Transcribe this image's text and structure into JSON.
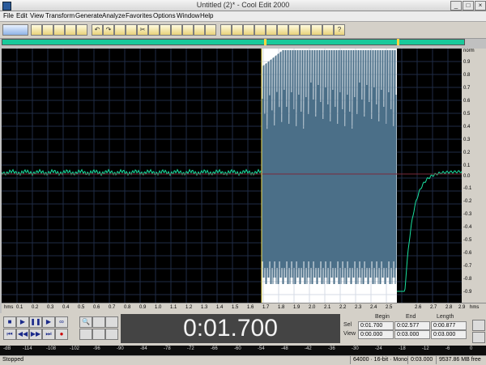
{
  "titlebar": {
    "title": "Untitled (2)* - Cool Edit 2000"
  },
  "menu": [
    "File",
    "Edit",
    "View",
    "Transform",
    "Generate",
    "Analyze",
    "Favorites",
    "Options",
    "Window",
    "Help"
  ],
  "toolbar": {
    "icons": [
      "waveform-view-icon",
      "new-file-icon",
      "open-icon",
      "save-icon",
      "close-icon",
      "undo-icon",
      "redo-icon",
      "repeat-icon",
      "copy-icon",
      "cut-icon",
      "paste-icon",
      "mix-paste-icon",
      "trim-icon",
      "delete-icon",
      "silence-icon",
      "select-icon",
      "cue-icon",
      "scripts-icon",
      "zoom-icon",
      "spectral-icon",
      "info-icon",
      "settings-icon",
      "note-icon",
      "help-icon"
    ]
  },
  "vertical_ruler": {
    "unit": "norm",
    "labels": [
      "0.9",
      "0.8",
      "0.7",
      "0.6",
      "0.5",
      "0.4",
      "0.3",
      "0.2",
      "0.1",
      "0.0",
      "-0.1",
      "-0.2",
      "-0.3",
      "-0.4",
      "-0.5",
      "-0.6",
      "-0.7",
      "-0.8",
      "-0.9"
    ]
  },
  "time_ruler": {
    "unit_start": "hms",
    "labels": [
      "0.1",
      "0.2",
      "0.3",
      "0.4",
      "0.5",
      "0.6",
      "0.7",
      "0.8",
      "0.9",
      "1.0",
      "1.1",
      "1.2",
      "1.3",
      "1.4",
      "1.5",
      "1.6",
      "1.7",
      "1.8",
      "1.9",
      "2.0",
      "2.1",
      "2.2",
      "2.3",
      "2.4",
      "2.5",
      "2.6",
      "2.7",
      "2.8",
      "2.9"
    ],
    "unit_end": "hms"
  },
  "transport": {
    "time_display": "0:01.700"
  },
  "selection": {
    "headers": {
      "begin": "Begin",
      "end": "End",
      "length": "Length"
    },
    "sel_label": "Sel",
    "view_label": "View",
    "sel": {
      "begin": "0:01.700",
      "end": "0:02.577",
      "length": "0:00.877"
    },
    "view": {
      "begin": "0:00.000",
      "end": "0:03.000",
      "length": "0:03.000"
    }
  },
  "meter": {
    "labels": [
      "-dB",
      "-114",
      "-108",
      "-102",
      "-96",
      "-90",
      "-84",
      "-78",
      "-72",
      "-66",
      "-60",
      "-54",
      "-48",
      "-42",
      "-36",
      "-30",
      "-24",
      "-18",
      "-12",
      "-6",
      "0"
    ]
  },
  "statusbar": {
    "state": "Stopped",
    "format": "64000 · 16-bit · Mono",
    "duration": "0:03.000",
    "free": "9537.86 MB free"
  },
  "colors": {
    "waveform": "#19e0a0",
    "selection_bg": "#ffffff",
    "selection_wave": "#4b6f88",
    "background": "#000000",
    "grid": "#2a3a55",
    "accent": "#19c99b"
  }
}
